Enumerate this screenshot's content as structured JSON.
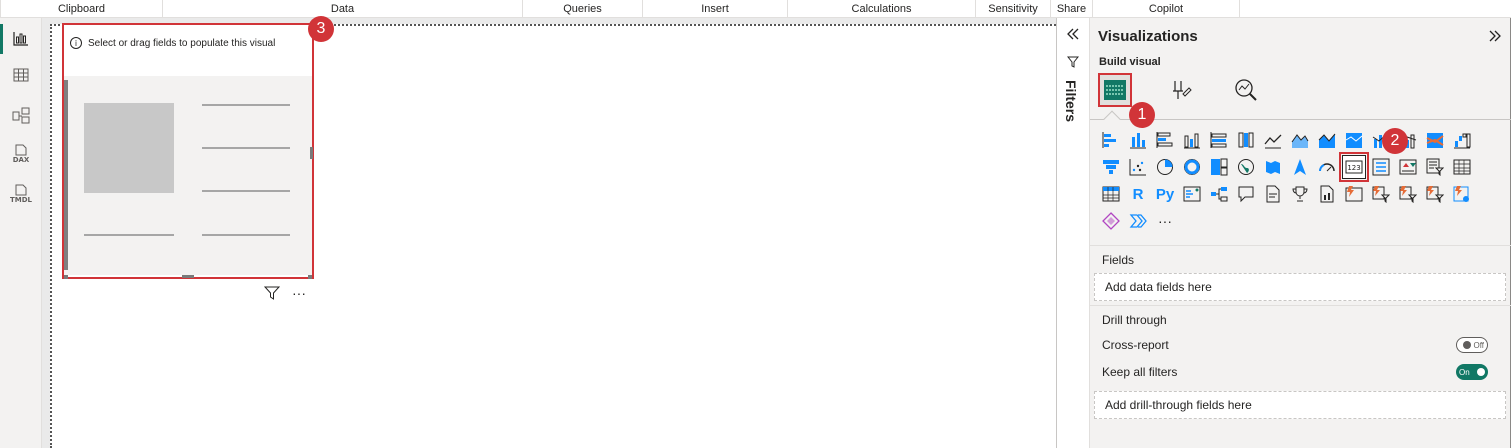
{
  "ribbon": {
    "groups": [
      "Clipboard",
      "Data",
      "Queries",
      "Insert",
      "Calculations",
      "Sensitivity",
      "Share",
      "Copilot"
    ]
  },
  "leftrail": {
    "items": [
      {
        "icon": "report-view-icon"
      },
      {
        "icon": "table-view-icon"
      },
      {
        "icon": "model-view-icon"
      },
      {
        "icon": "dax-query-view-icon",
        "label": "DAX"
      },
      {
        "icon": "tmdl-view-icon",
        "label": "TMDL"
      }
    ]
  },
  "canvas": {
    "visual": {
      "placeholder_text": "Select or drag fields to populate this visual"
    }
  },
  "badges": [
    "1",
    "2",
    "3"
  ],
  "filters": {
    "label": "Filters",
    "expand_icon": "chevrons-left-icon"
  },
  "visualizations": {
    "title": "Visualizations",
    "collapse_icon": "chevrons-right-icon",
    "build_label": "Build visual",
    "modes": [
      "add-visual-icon",
      "format-visual-icon",
      "analytics-icon"
    ],
    "r_label": "R",
    "py_label": "Py",
    "more_label": "···",
    "fields": {
      "label": "Fields",
      "placeholder": "Add data fields here"
    },
    "drill": {
      "label": "Drill through",
      "cross_report": "Cross-report",
      "cross_report_state": "Off",
      "keep_filters": "Keep all filters",
      "keep_filters_state": "On",
      "placeholder": "Add drill-through fields here"
    }
  },
  "colors": {
    "accent": "#117865",
    "highlight": "#d13438",
    "icon_blue": "#118dff"
  }
}
